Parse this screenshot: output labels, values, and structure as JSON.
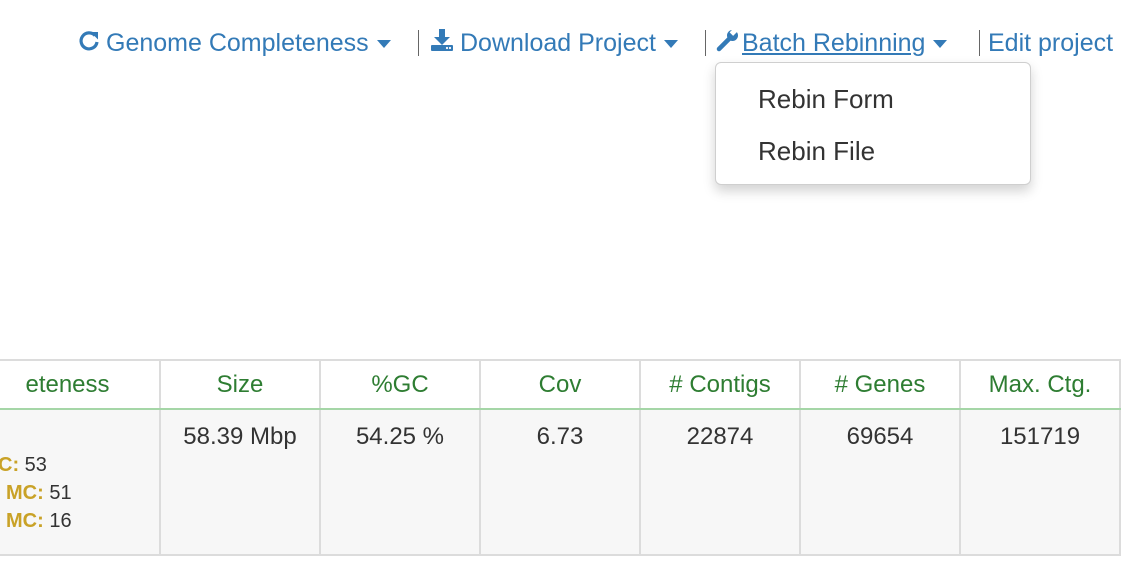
{
  "toolbar": {
    "genome_completeness": "Genome Completeness",
    "download_project": "Download Project",
    "batch_rebinning": "Batch Rebinning",
    "edit_project": "Edit project"
  },
  "rebin_menu": {
    "items": [
      {
        "label": "Rebin Form"
      },
      {
        "label": "Rebin File"
      }
    ]
  },
  "table": {
    "headers": [
      "eteness",
      "Size",
      "%GC",
      "Cov",
      "# Contigs",
      "# Genes",
      "Max. Ctg."
    ],
    "row": {
      "completeness": [
        {
          "label": "C:",
          "value": "53"
        },
        {
          "label": "MC:",
          "value": "51"
        },
        {
          "label": "MC:",
          "value": "16"
        }
      ],
      "size": "58.39 Mbp",
      "gc": "54.25 %",
      "cov": "6.73",
      "contigs": "22874",
      "genes": "69654",
      "max_ctg": "151719"
    }
  },
  "colors": {
    "link": "#337ab7",
    "header_text": "#2e7d32",
    "mc_label": "#c9a227"
  }
}
